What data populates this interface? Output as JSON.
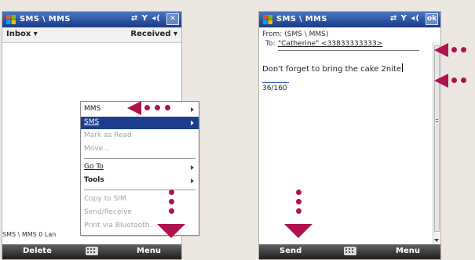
{
  "left_screen": {
    "title": "SMS \\ MMS",
    "status_icons": "⇄ Y ◂(",
    "close_label": "✕",
    "folder": "Inbox ▾",
    "sort": "Received ▾",
    "status_line": "SMS \\ MMS 0 Lan",
    "left_softkey": "Delete",
    "right_softkey": "Menu",
    "menu": {
      "items": [
        {
          "label": "MMS",
          "submenu": true,
          "state": "normal"
        },
        {
          "label": "SMS",
          "submenu": true,
          "state": "selected"
        },
        {
          "label": "Mark as Read",
          "submenu": false,
          "state": "disabled"
        },
        {
          "label": "Move...",
          "submenu": false,
          "state": "disabled"
        },
        {
          "label": "Go To",
          "submenu": true,
          "state": "normal"
        },
        {
          "label": "Tools",
          "submenu": true,
          "state": "normal"
        },
        {
          "label": "Copy to SIM",
          "submenu": false,
          "state": "disabled"
        },
        {
          "label": "Send/Receive",
          "submenu": false,
          "state": "disabled"
        },
        {
          "label": "Print via Bluetooth...",
          "submenu": false,
          "state": "disabled"
        }
      ]
    }
  },
  "right_screen": {
    "title": "SMS \\ MMS",
    "status_icons": "⇄ Y ◂(",
    "ok_label": "ok",
    "from_line": "From: (SMS \\ MMS)",
    "to_label": "To:",
    "to_value": "\"Catherine\" <33833333333>",
    "message": "Don't forget to bring the cake 2nite",
    "char_count": "36/160",
    "left_softkey": "Send",
    "right_softkey": "Menu"
  },
  "colors": {
    "title_bar": "#173b86",
    "highlight": "#1b3f8e",
    "callout": "#b0124e",
    "softkey_bar": "#2c2c2c",
    "background": "#ece7e1"
  }
}
